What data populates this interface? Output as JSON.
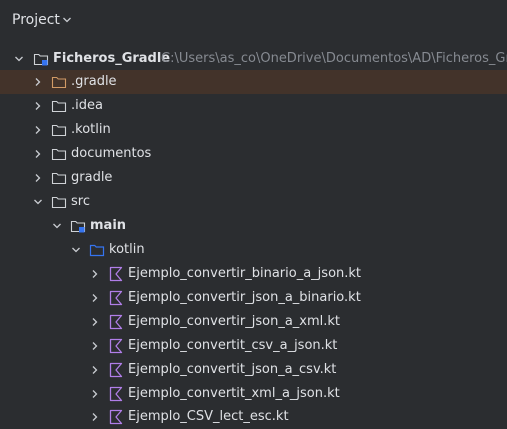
{
  "panel": {
    "title": "Project",
    "project_name": "Ficheros_Gradle",
    "project_path": "C:\\Users\\as_co\\OneDrive\\Documentos\\AD\\Ficheros_Gradle"
  },
  "tree": {
    "gradle_hidden": ".gradle",
    "idea": ".idea",
    "kotlin_hidden": ".kotlin",
    "documentos": "documentos",
    "gradle": "gradle",
    "src": "src",
    "main": "main",
    "kotlin": "kotlin",
    "files": [
      "Ejemplo_convertir_binario_a_json.kt",
      "Ejemplo_convertir_json_a_binario.kt",
      "Ejemplo_convertir_json_a_xml.kt",
      "Ejemplo_convertit_csv_a_json.kt",
      "Ejemplo_convertit_json_a_csv.kt",
      "Ejemplo_convertit_xml_a_json.kt",
      "Ejemplo_CSV_lect_esc.kt"
    ]
  },
  "colors": {
    "background": "#2b2d30",
    "selected_row": "#43332a",
    "folder_excluded": "#d19a66",
    "folder_default": "#cfd2d6",
    "folder_source": "#3574f0",
    "kotlin_icon": "#b07ee8"
  },
  "icons": {
    "chevron": "chevron-down-icon",
    "expand": "chevron-right-icon",
    "collapse": "chevron-down-icon",
    "folder": "folder-icon",
    "module": "module-folder-icon",
    "source_folder": "source-folder-icon",
    "kotlin_file": "kotlin-file-icon"
  }
}
